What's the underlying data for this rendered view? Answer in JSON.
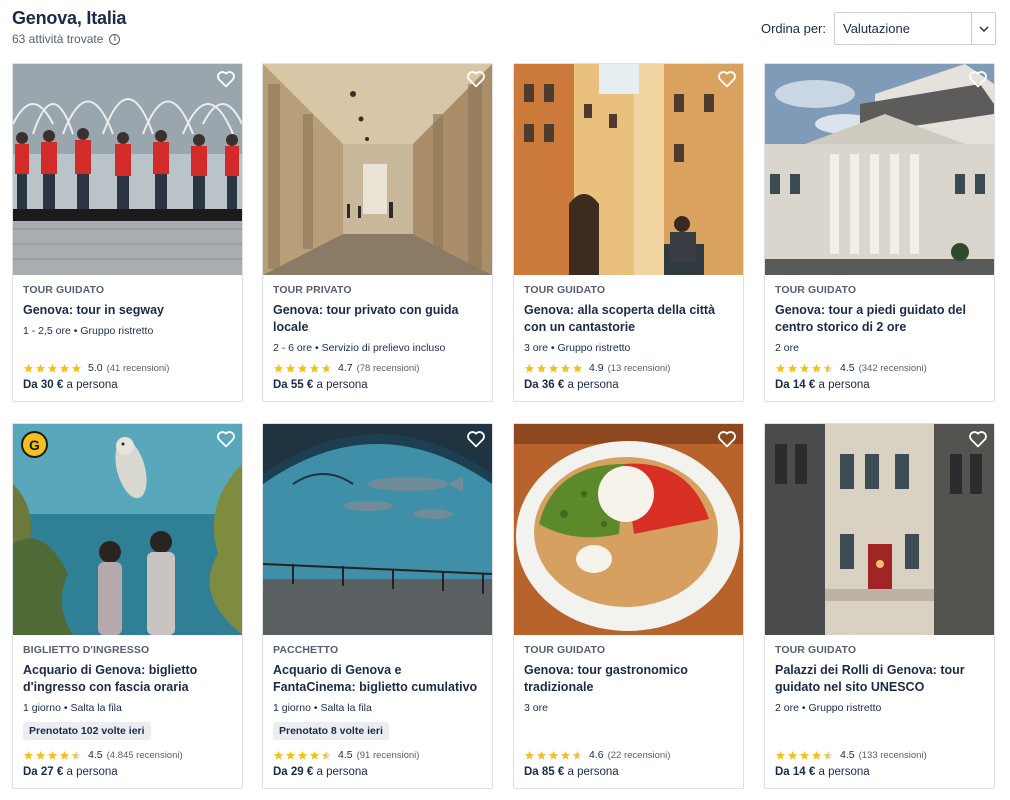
{
  "header": {
    "title": "Genova, Italia",
    "subtitle": "63 attività trovate",
    "info_icon": "info-icon"
  },
  "sort": {
    "label": "Ordina per:",
    "selected": "Valutazione"
  },
  "colors": {
    "text": "#1a2b49",
    "star": "#f4c01e",
    "border": "#dcdfe4"
  },
  "cards": [
    {
      "category": "TOUR GUIDATO",
      "title": "Genova: tour in segway",
      "meta": "1 - 2,5 ore • Gruppo ristretto",
      "booked": "",
      "rating": "5.0",
      "stars": 5,
      "reviews": "(41 recensioni)",
      "price_prefix": "Da 30 €",
      "price_suffix": "a persona"
    },
    {
      "category": "TOUR PRIVATO",
      "title": "Genova: tour privato con guida locale",
      "meta": "2 - 6 ore • Servizio di prelievo incluso",
      "booked": "",
      "rating": "4.7",
      "stars": 4.7,
      "reviews": "(78 recensioni)",
      "price_prefix": "Da 55 €",
      "price_suffix": "a persona"
    },
    {
      "category": "TOUR GUIDATO",
      "title": "Genova: alla scoperta della città con un cantastorie",
      "meta": "3 ore • Gruppo ristretto",
      "booked": "",
      "rating": "4.9",
      "stars": 4.9,
      "reviews": "(13 recensioni)",
      "price_prefix": "Da 36 €",
      "price_suffix": "a persona"
    },
    {
      "category": "TOUR GUIDATO",
      "title": "Genova: tour a piedi guidato del centro storico di 2 ore",
      "meta": "2 ore",
      "booked": "",
      "rating": "4.5",
      "stars": 4.5,
      "reviews": "(342 recensioni)",
      "price_prefix": "Da 14 €",
      "price_suffix": "a persona"
    },
    {
      "category": "BIGLIETTO D'INGRESSO",
      "title": "Acquario di Genova: biglietto d'ingresso con fascia oraria",
      "meta": "1 giorno • Salta la fila",
      "booked": "Prenotato 102 volte ieri",
      "rating": "4.5",
      "stars": 4.5,
      "reviews": "(4.845 recensioni)",
      "price_prefix": "Da 27 €",
      "price_suffix": "a persona"
    },
    {
      "category": "PACCHETTO",
      "title": "Acquario di Genova e FantaCinema: biglietto cumulativo",
      "meta": "1 giorno • Salta la fila",
      "booked": "Prenotato 8 volte ieri",
      "rating": "4.5",
      "stars": 4.5,
      "reviews": "(91 recensioni)",
      "price_prefix": "Da 29 €",
      "price_suffix": "a persona"
    },
    {
      "category": "TOUR GUIDATO",
      "title": "Genova: tour gastronomico tradizionale",
      "meta": "3 ore",
      "booked": "",
      "rating": "4.6",
      "stars": 4.6,
      "reviews": "(22 recensioni)",
      "price_prefix": "Da 85 €",
      "price_suffix": "a persona"
    },
    {
      "category": "TOUR GUIDATO",
      "title": "Palazzi dei Rolli di Genova: tour guidato nel sito UNESCO",
      "meta": "2 ore • Gruppo ristretto",
      "booked": "",
      "rating": "4.5",
      "stars": 4.5,
      "reviews": "(133 recensioni)",
      "price_prefix": "Da 14 €",
      "price_suffix": "a persona"
    }
  ],
  "badge_logo": "G"
}
